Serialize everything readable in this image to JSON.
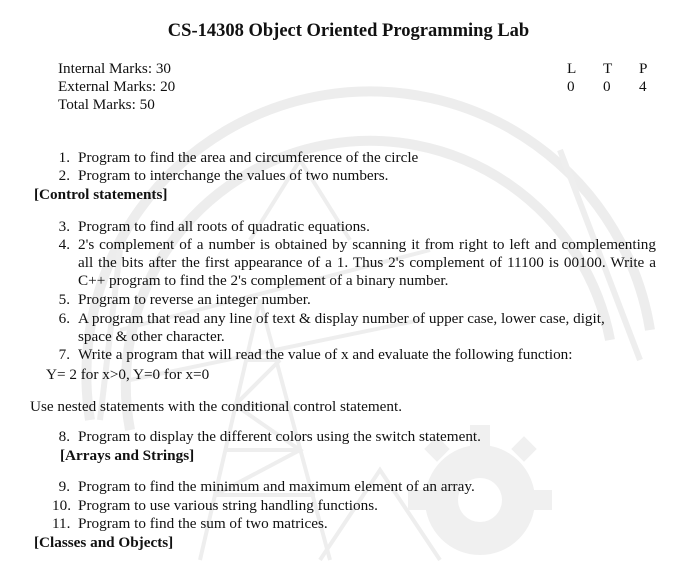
{
  "doc": {
    "title": "CS-14308 Object Oriented Programming Lab",
    "marks": [
      "Internal Marks: 30",
      "External Marks: 20",
      "Total Marks: 50"
    ],
    "ltp_header": [
      "L",
      "T",
      "P"
    ],
    "ltp_values": [
      "0",
      "0",
      "4"
    ],
    "items": [
      {
        "num": "1.",
        "text": "Program to find the area and circumference of the circle"
      },
      {
        "num": "2.",
        "text": "Program to interchange the values of two numbers."
      },
      {
        "num": "3.",
        "text": "Program to find all roots of quadratic equations."
      },
      {
        "num": "4.",
        "text": "2's complement of a number is obtained by scanning it from right to left and complementing all the bits after the first appearance of a 1. Thus 2's complement of 11100 is 00100. Write a C++ program to find the 2's complement of a binary number."
      },
      {
        "num": "5.",
        "text": "Program to reverse an integer number."
      },
      {
        "num": "6.",
        "text": "A program that read any line of text & display number of upper case, lower case, digit, space & other character."
      },
      {
        "num": "7.",
        "text": "Write a program that will read the value of x and evaluate the following function:"
      },
      {
        "num": "8.",
        "text": "Program to display the different colors using the switch statement."
      },
      {
        "num": "9.",
        "text": "Program to find the minimum and maximum element of an array."
      },
      {
        "num": "10.",
        "text": "Program to use various string handling functions."
      },
      {
        "num": "11.",
        "text": "Program to find the sum of two matrices."
      }
    ],
    "sections": [
      "[Control statements]",
      "[Arrays and Strings]",
      "[Classes and Objects]"
    ],
    "function_line": "Y= 2 for x>0, Y=0 for x=0",
    "nested_note": "Use nested statements with the conditional control statement."
  }
}
